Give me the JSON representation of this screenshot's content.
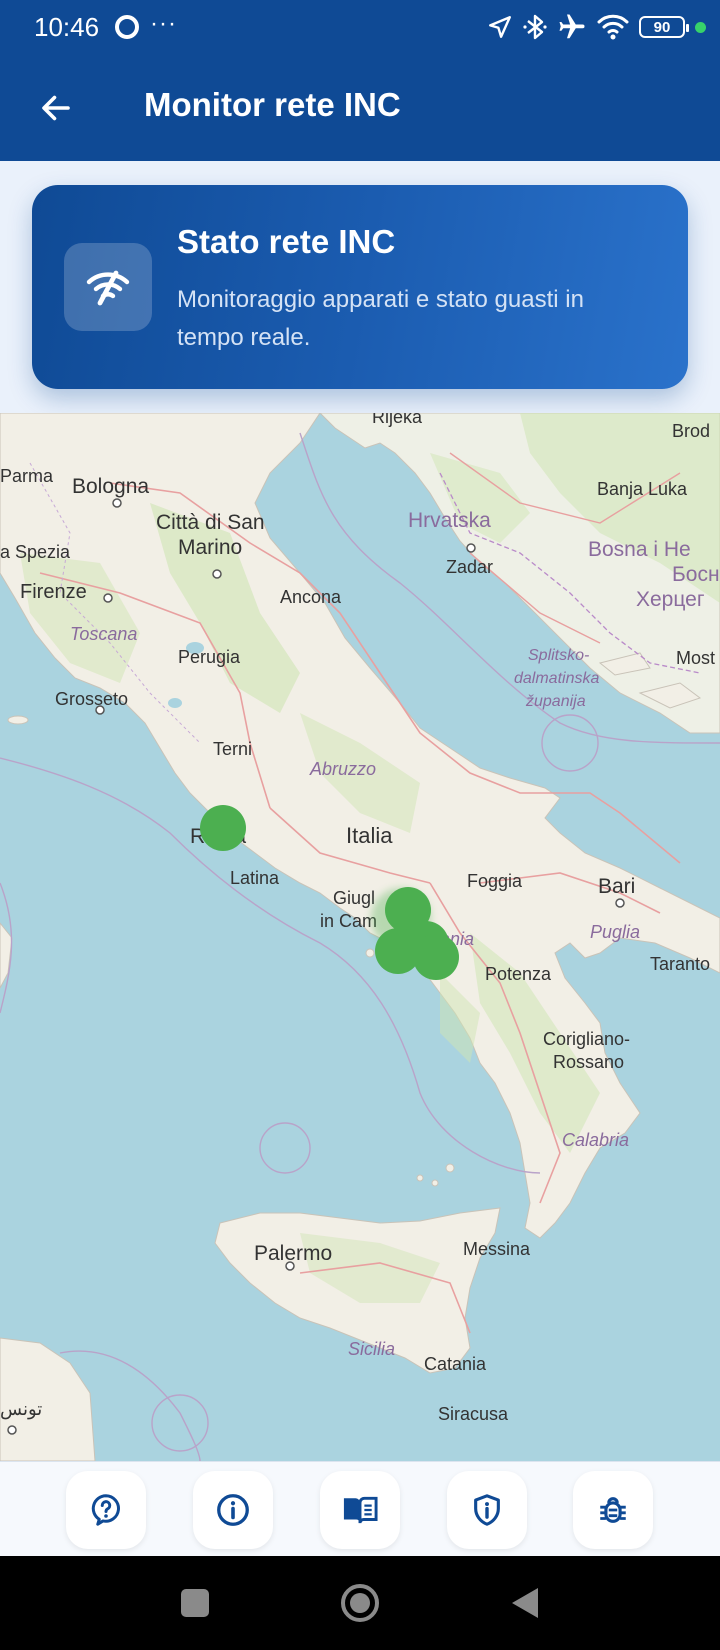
{
  "status_bar": {
    "time": "10:46",
    "dots": "···",
    "battery": "90",
    "icons": [
      "location-arrow-icon",
      "bluetooth-icon",
      "airplane-mode-icon",
      "wifi-icon",
      "battery-icon",
      "camera-in-use-dot"
    ]
  },
  "app_bar": {
    "title": "Monitor rete INC",
    "back_icon": "arrow-left-icon"
  },
  "hero": {
    "title": "Stato rete INC",
    "subtitle": "Monitoraggio apparati e stato guasti in tempo reale.",
    "icon": "wifi-off-icon"
  },
  "map": {
    "labels": {
      "rijeka": "Rijeka",
      "brod": "Brod",
      "parma": "Parma",
      "bologna": "Bologna",
      "citta_di_san": "Città di San",
      "marino": "Marino",
      "hrvatska": "Hrvatska",
      "banja_luka": "Banja Luka",
      "la_spezia": "a Spezia",
      "zadar": "Zadar",
      "bosna": "Bosna i He",
      "bosna_cyr": "Босн",
      "herceg_cyr": "Херцег",
      "firenze": "Firenze",
      "ancona": "Ancona",
      "toscana": "Toscana",
      "perugia": "Perugia",
      "splitsko": "Splitsko-",
      "dalmatinska": "dalmatinska",
      "zupanija": "županija",
      "most": "Most",
      "grosseto": "Grosseto",
      "terni": "Terni",
      "abruzzo": "Abruzzo",
      "roma": "Roma",
      "italia": "Italia",
      "latina": "Latina",
      "giugliano": "Giugl",
      "in_campania": "in Cam",
      "foggia": "Foggia",
      "bari": "Bari",
      "puglia": "Puglia",
      "campania_frag": "ania",
      "potenza": "Potenza",
      "taranto": "Taranto",
      "corigliano": "Corigliano-",
      "rossano": "Rossano",
      "calabria": "Calabria",
      "palermo": "Palermo",
      "messina": "Messina",
      "sicilia": "Sicilia",
      "catania": "Catania",
      "tunisia": "تونس",
      "siracusa": "Siracusa"
    },
    "markers_status": "ok",
    "marker_color": "#4caf50"
  },
  "toolbar": {
    "buttons": [
      "help-icon",
      "info-icon",
      "manual-icon",
      "privacy-shield-icon",
      "bug-report-icon"
    ]
  },
  "nav_bar": {
    "buttons": [
      "recents-button",
      "home-button",
      "back-button"
    ]
  },
  "colors": {
    "primary": "#0f4a95",
    "card_gradient_end": "#2a72cb",
    "marker": "#4caf50",
    "background": "#eaf1fb"
  }
}
